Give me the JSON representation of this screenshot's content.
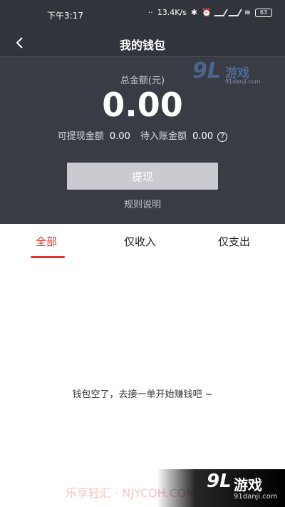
{
  "status_bar": {
    "time": "下午3:17",
    "network_speed": "13.4K/s",
    "battery": "63"
  },
  "header": {
    "title": "我的钱包"
  },
  "wallet": {
    "total_label": "总金额(元)",
    "total_value": "0.00",
    "withdrawable_label": "可提现金额",
    "withdrawable_value": "0.00",
    "pending_label": "待入账金额",
    "pending_value": "0.00",
    "withdraw_button": "提现",
    "rules_link": "规则说明"
  },
  "tabs": [
    {
      "label": "全部",
      "active": true
    },
    {
      "label": "仅收入",
      "active": false
    },
    {
      "label": "仅支出",
      "active": false
    }
  ],
  "empty_state": {
    "message": "钱包空了，去接一单开始赚钱吧 ~"
  },
  "watermarks": {
    "top_brand_number": "9L",
    "top_brand_cn": "游戏",
    "top_brand_url": "91danji.com",
    "bottom_left": "乐享轻汇 · NJYCQH.COM",
    "bottom_brand_number": "9L",
    "bottom_brand_cn": "游戏",
    "bottom_brand_url": "91danji.com"
  },
  "colors": {
    "header_bg": "#3a3c45",
    "accent_red": "#e2302a",
    "button_disabled": "#c9cbd0"
  }
}
